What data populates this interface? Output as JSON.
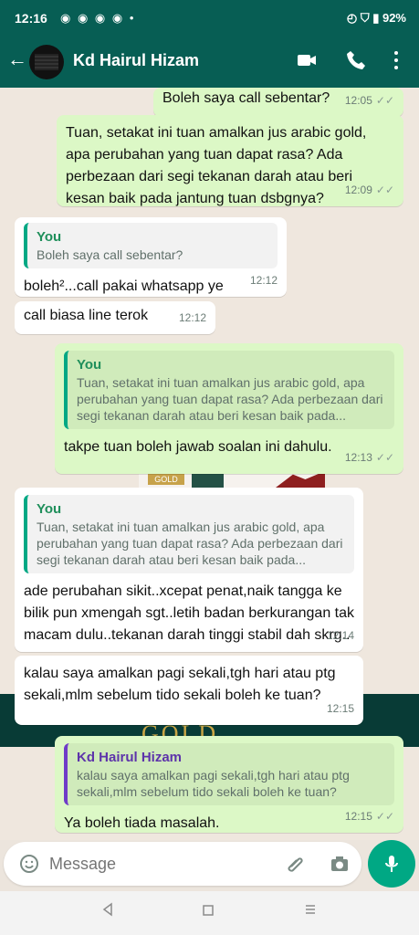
{
  "status_bar": {
    "time": "12:16",
    "battery": "92%"
  },
  "header": {
    "contact_name": "Kd Hairul Hizam"
  },
  "background_text": "GOLD",
  "background_label": "GOLD",
  "messages": [
    {
      "text": "Boleh saya call sebentar?",
      "time": "12:05"
    },
    {
      "text": "Tuan, setakat ini tuan amalkan jus arabic gold, apa perubahan yang tuan dapat rasa? Ada perbezaan dari segi tekanan darah atau beri kesan baik pada jantung tuan dsbgnya?",
      "time": "12:09"
    },
    {
      "reply_title": "You",
      "reply_text": "Boleh saya call sebentar?",
      "text": "boleh²...call pakai whatsapp ye",
      "time": "12:12"
    },
    {
      "text": "call biasa line terok",
      "time": "12:12"
    },
    {
      "reply_title": "You",
      "reply_text": "Tuan, setakat ini tuan amalkan jus arabic gold, apa perubahan yang tuan dapat rasa? Ada perbezaan dari segi tekanan darah atau beri kesan baik pada...",
      "text": "takpe tuan boleh jawab soalan ini dahulu.",
      "time": "12:13"
    },
    {
      "reply_title": "You",
      "reply_text": "Tuan, setakat ini tuan amalkan jus arabic gold, apa perubahan yang tuan dapat rasa? Ada perbezaan dari segi tekanan darah atau beri kesan baik pada...",
      "text": "ade perubahan sikit..xcepat penat,naik tangga ke bilik pun xmengah sgt..letih badan berkurangan tak macam dulu..tekanan darah tinggi stabil dah skrg..",
      "time": "12:14"
    },
    {
      "text": "kalau saya amalkan pagi sekali,tgh hari atau ptg sekali,mlm sebelum tido sekali boleh ke tuan?",
      "time": "12:15"
    },
    {
      "reply_title": "Kd Hairul Hizam",
      "reply_text": "kalau saya amalkan pagi sekali,tgh hari atau ptg sekali,mlm sebelum tido sekali boleh ke tuan?",
      "text": "Ya boleh tiada masalah.",
      "time": "12:15"
    }
  ],
  "composer": {
    "placeholder": "Message"
  },
  "colors": {
    "header": "#075e54",
    "outgoing": "#dcf8c6",
    "incoming": "#ffffff",
    "accent": "#00a884"
  },
  "icons": {
    "back": "arrow-left-icon",
    "video": "video-call-icon",
    "call": "phone-icon",
    "more": "more-vert-icon",
    "emoji": "emoji-icon",
    "attach": "attach-icon",
    "camera": "camera-icon",
    "mic": "mic-icon",
    "nav_back": "nav-back-icon",
    "nav_home": "nav-home-icon",
    "nav_menu": "nav-menu-icon"
  }
}
